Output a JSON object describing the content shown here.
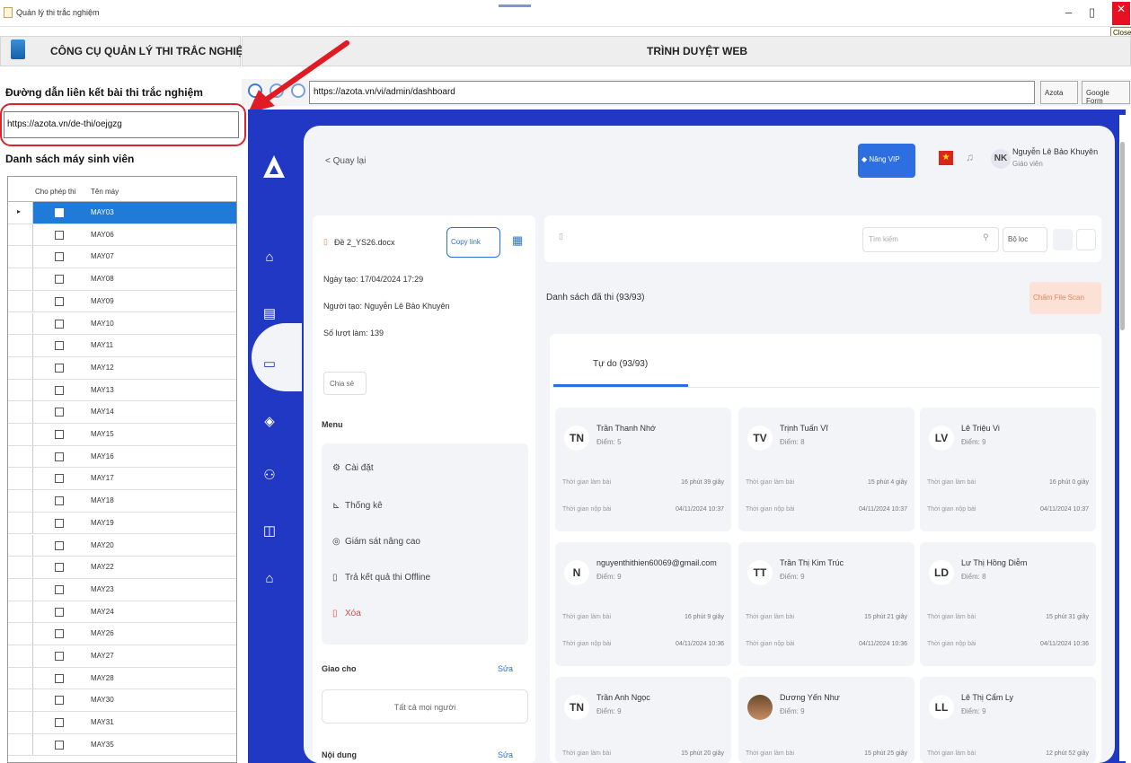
{
  "window": {
    "title": "Quản lý thi trắc nghiệm",
    "close_tooltip": "Close",
    "minimize": "–",
    "maximize": "▯",
    "close": "✕"
  },
  "left": {
    "app_title": "CÔNG CỤ QUẢN LÝ THI TRẮC NGHIỆM",
    "link_label": "Đường dẫn liên kết bài thi trắc nghiệm",
    "link_value": "https://azota.vn/de-thi/oejgzg",
    "list_label": "Danh sách máy sinh viên",
    "columns": [
      "Cho phép thi",
      "Tên máy"
    ],
    "machines": [
      "MAY03",
      "MAY06",
      "MAY07",
      "MAY08",
      "MAY09",
      "MAY10",
      "MAY11",
      "MAY12",
      "MAY13",
      "MAY14",
      "MAY15",
      "MAY16",
      "MAY17",
      "MAY18",
      "MAY19",
      "MAY20",
      "MAY22",
      "MAY23",
      "MAY24",
      "MAY26",
      "MAY27",
      "MAY28",
      "MAY30",
      "MAY31",
      "MAY35"
    ]
  },
  "browser": {
    "title": "TRÌNH DUYỆT WEB",
    "url": "https://azota.vn/vi/admin/dashboard",
    "btn_azota": "Azota",
    "btn_google": "Google Form"
  },
  "page": {
    "back": "< Quay lại",
    "vip": "Nâng VIP",
    "user_initials": "NK",
    "user_name": "Nguyễn Lê Bảo Khuyên",
    "user_role": "Giáo viên",
    "file_name": "Đề 2_YS26.docx",
    "copy_link": "Copy link",
    "created": "Ngày tạo: 17/04/2024 17:29",
    "creator": "Người tạo: Nguyễn Lê Bảo Khuyên",
    "attempts": "Số lượt làm: 139",
    "share": "Chia sẻ",
    "menu_title": "Menu",
    "menu": [
      "Cài đặt",
      "Thống kê",
      "Giám sát nâng cao",
      "Trả kết quả thi Offline",
      "Xóa"
    ],
    "assign_title": "Giao cho",
    "assign_value": "Tất cả mọi người",
    "edit": "Sửa",
    "content_title": "Nội dung",
    "search_placeholder": "Tìm kiếm",
    "filter": "Bộ lọc",
    "list_title": "Danh sách đã thi (93/93)",
    "export": "Chấm File Scan",
    "tab": "Tự do (93/93)",
    "label_time": "Thời gian làm bài",
    "label_submit": "Thời gian nộp bài",
    "students": [
      {
        "initials": "TN",
        "name": "Trần Thanh Nhớ",
        "score": "Điểm: 5",
        "time": "16 phút 39 giây",
        "submit": "04/11/2024 10:37"
      },
      {
        "initials": "TV",
        "name": "Trịnh Tuấn Vĩ",
        "score": "Điểm: 8",
        "time": "15 phút 4 giây",
        "submit": "04/11/2024 10:37"
      },
      {
        "initials": "LV",
        "name": "Lê Triệu Vi",
        "score": "Điểm: 9",
        "time": "16 phút 0 giây",
        "submit": "04/11/2024 10:37"
      },
      {
        "initials": "N",
        "name": "nguyenthithien60069@gmail.com",
        "score": "Điểm: 9",
        "time": "16 phút 9 giây",
        "submit": "04/11/2024 10:36"
      },
      {
        "initials": "TT",
        "name": "Trần Thị Kim Trúc",
        "score": "Điểm: 9",
        "time": "15 phút 21 giây",
        "submit": "04/11/2024 10:36"
      },
      {
        "initials": "LD",
        "name": "Lư Thị Hồng Diễm",
        "score": "Điểm: 8",
        "time": "15 phút 31 giây",
        "submit": "04/11/2024 10:36"
      },
      {
        "initials": "TN",
        "name": "Trần Anh Ngọc",
        "score": "Điểm: 9",
        "time": "15 phút 20 giây",
        "submit": ""
      },
      {
        "initials": "",
        "name": "Dương Yến Như",
        "score": "Điểm: 9",
        "time": "15 phút 25 giây",
        "submit": ""
      },
      {
        "initials": "LL",
        "name": "Lê Thị Cẩm Ly",
        "score": "Điểm: 9",
        "time": "12 phút 52 giây",
        "submit": ""
      }
    ]
  },
  "colors": {
    "brand_blue": "#2038c4",
    "accent": "#2d6fe0",
    "selected_row": "#1f7ad8",
    "annotation_red": "#d9232d"
  }
}
